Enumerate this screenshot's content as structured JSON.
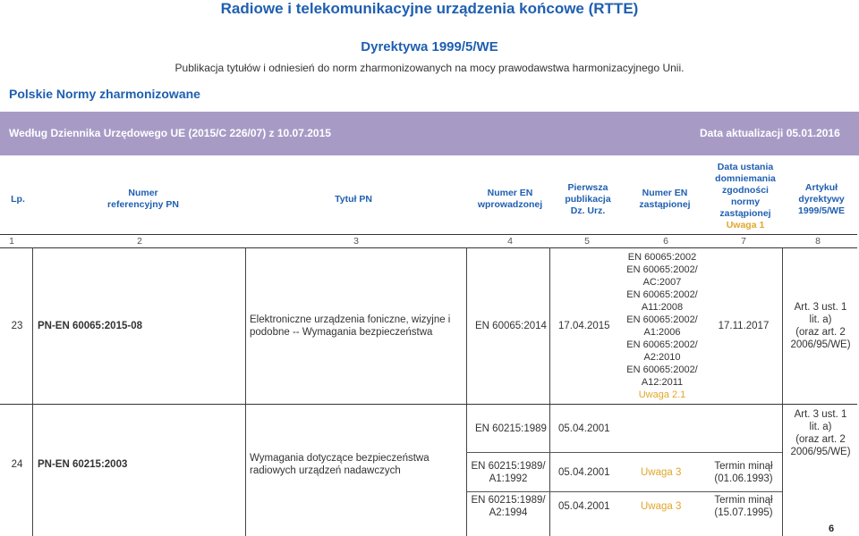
{
  "title": "Radiowe i telekomunikacyjne urządzenia końcowe (RTTE)",
  "directive": "Dyrektywa 1999/5/WE",
  "subtitle": "Publikacja tytułów i odniesień do norm zharmonizowanych na mocy prawodawstwa harmonizacyjnego Unii.",
  "section_label": "Polskie Normy zharmonizowane",
  "band": {
    "left": "Według Dziennika Urzędowego UE (2015/C 226/07) z 10.07.2015",
    "right": "Data aktualizacji 05.01.2016"
  },
  "headers": {
    "lp": "Lp.",
    "pn_num_1": "Numer",
    "pn_num_2": "referencyjny PN",
    "title": "Tytuł PN",
    "en_1": "Numer EN",
    "en_2": "wprowadzonej",
    "pub_1": "Pierwsza",
    "pub_2": "publikacja",
    "pub_3": "Dz. Urz.",
    "repl_1": "Numer EN",
    "repl_2": "zastąpionej",
    "date_1": "Data ustania",
    "date_2": "domniemania",
    "date_3": "zgodności",
    "date_4": "normy",
    "date_5": "zastąpionej",
    "date_note": "Uwaga 1",
    "art_1": "Artykuł",
    "art_2": "dyrektywy",
    "art_3": "1999/5/WE"
  },
  "col_numbers": [
    "1",
    "2",
    "3",
    "4",
    "5",
    "6",
    "7",
    "8"
  ],
  "rows": [
    {
      "lp": "23",
      "pn": "PN-EN 60065:2015-08",
      "title": "Elektroniczne urządzenia foniczne, wizyjne i podobne -- Wymagania bezpieczeństwa",
      "en": "EN 60065:2014",
      "pub": "17.04.2015",
      "replaced": [
        "EN 60065:2002",
        "EN 60065:2002/",
        "AC:2007",
        "EN 60065:2002/",
        "A11:2008",
        "EN 60065:2002/",
        "A1:2006",
        "EN 60065:2002/",
        "A2:2010",
        "EN 60065:2002/",
        "A12:2011"
      ],
      "replaced_note": "Uwaga 2.1",
      "date": "17.11.2017",
      "article": [
        "Art. 3 ust. 1",
        "lit. a)",
        "(oraz art. 2",
        "2006/95/WE)"
      ]
    },
    {
      "lp": "24",
      "pn": "PN-EN 60215:2003",
      "title": "Wymagania dotyczące bezpieczeństwa radiowych urządzeń nadawczych",
      "sub": [
        {
          "en": [
            "EN 60215:1989"
          ],
          "pub": "05.04.2001",
          "replaced": "",
          "date": []
        },
        {
          "en": [
            "EN 60215:1989/",
            "A1:1992"
          ],
          "pub": "05.04.2001",
          "replaced": "Uwaga 3",
          "date": [
            "Termin minął",
            "(01.06.1993)"
          ]
        },
        {
          "en": [
            "EN 60215:1989/",
            "A2:1994"
          ],
          "pub": "05.04.2001",
          "replaced": "Uwaga 3",
          "date": [
            "Termin minął",
            "(15.07.1995)"
          ]
        }
      ],
      "article": [
        "Art. 3 ust. 1",
        "lit. a)",
        "(oraz art. 2",
        "2006/95/WE)"
      ]
    }
  ],
  "page_number": "6"
}
